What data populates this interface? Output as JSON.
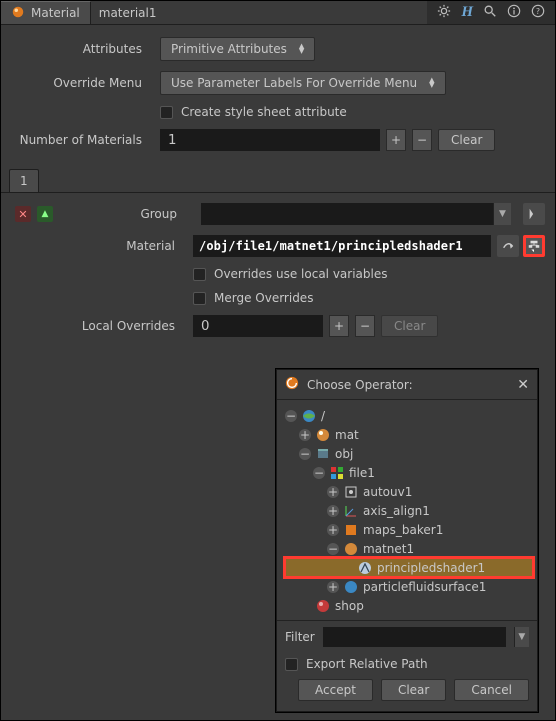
{
  "header": {
    "node_type_label": "Material",
    "node_name": "material1"
  },
  "parms": {
    "attributes_label": "Attributes",
    "attributes_value": "Primitive Attributes",
    "override_menu_label": "Override Menu",
    "override_menu_value": "Use Parameter Labels For Override Menu",
    "stylesheet_label": "Create style sheet attribute",
    "num_materials_label": "Number of Materials",
    "num_materials_value": "1",
    "clear_label": "Clear"
  },
  "folder": {
    "tab_label": "1"
  },
  "material_block": {
    "group_label": "Group",
    "group_value": "",
    "material_label": "Material",
    "material_value": "/obj/file1/matnet1/principledshader1",
    "overrides_local_label": "Overrides use local variables",
    "merge_overrides_label": "Merge Overrides",
    "local_overrides_label": "Local Overrides",
    "local_overrides_value": "0",
    "clear_label": "Clear"
  },
  "dialog": {
    "title": "Choose Operator:",
    "filter_label": "Filter",
    "filter_value": "",
    "export_relative_label": "Export Relative Path",
    "accept_label": "Accept",
    "clear_label": "Clear",
    "cancel_label": "Cancel",
    "tree": {
      "root": "/",
      "items": [
        {
          "name": "mat",
          "icon": "mat",
          "depth": 1,
          "expander": "plus"
        },
        {
          "name": "obj",
          "icon": "obj",
          "depth": 1,
          "expander": "minus"
        },
        {
          "name": "file1",
          "icon": "file",
          "depth": 2,
          "expander": "minus"
        },
        {
          "name": "autouv1",
          "icon": "autouv",
          "depth": 3,
          "expander": "plus"
        },
        {
          "name": "axis_align1",
          "icon": "axis",
          "depth": 3,
          "expander": "plus"
        },
        {
          "name": "maps_baker1",
          "icon": "maps",
          "depth": 3,
          "expander": "plus"
        },
        {
          "name": "matnet1",
          "icon": "matnet",
          "depth": 3,
          "expander": "minus"
        },
        {
          "name": "principledshader1",
          "icon": "shader",
          "depth": 4,
          "expander": "none",
          "selected": true
        },
        {
          "name": "particlefluidsurface1",
          "icon": "pfs",
          "depth": 3,
          "expander": "plus"
        },
        {
          "name": "shop",
          "icon": "shop",
          "depth": 1,
          "expander": "none"
        }
      ]
    }
  },
  "icons": {
    "gear": "gear-icon",
    "houdini": "h-icon",
    "search": "search-icon",
    "info": "info-icon",
    "help": "help-icon",
    "node": "material-node-icon",
    "chooser": "operator-chooser-icon",
    "jump": "jump-icon",
    "arrow": "select-arrow-icon",
    "close": "close-icon",
    "houdini-logo": "houdini-logo-icon"
  }
}
